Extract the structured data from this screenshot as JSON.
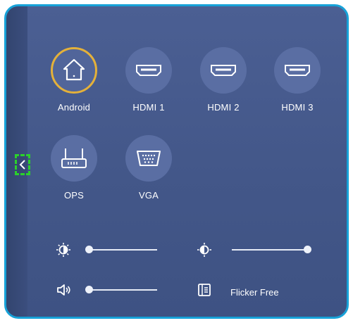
{
  "sources": [
    {
      "label": "Android",
      "icon": "home-icon",
      "active": true
    },
    {
      "label": "HDMI 1",
      "icon": "hdmi-icon",
      "active": false
    },
    {
      "label": "HDMI 2",
      "icon": "hdmi-icon",
      "active": false
    },
    {
      "label": "HDMI 3",
      "icon": "hdmi-icon",
      "active": false
    },
    {
      "label": "OPS",
      "icon": "router-icon",
      "active": false
    },
    {
      "label": "VGA",
      "icon": "vga-icon",
      "active": false
    }
  ],
  "controls": {
    "brightness": {
      "icon": "brightness-icon",
      "value": 0
    },
    "contrast": {
      "icon": "contrast-icon",
      "value": 100
    },
    "volume": {
      "icon": "speaker-icon",
      "value": 0
    },
    "flicker_free": {
      "icon": "flicker-free-icon",
      "label": "Flicker Free"
    }
  },
  "colors": {
    "panel_border": "#17a2d8",
    "active_ring": "#e4b13a",
    "collapse_outline": "#2bd12b"
  }
}
